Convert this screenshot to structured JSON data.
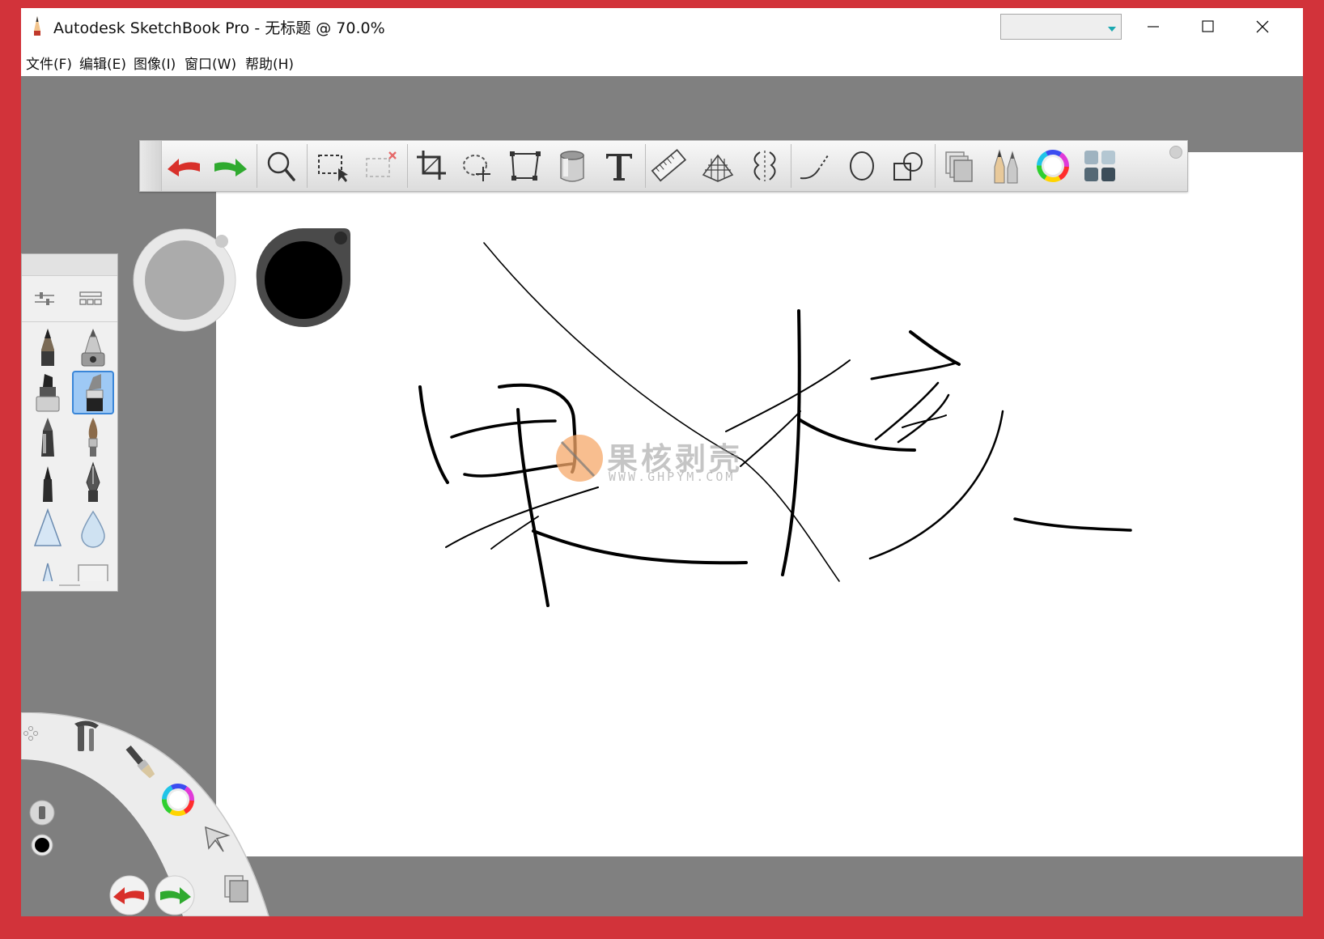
{
  "window": {
    "title": "Autodesk SketchBook Pro - 无标题 @ 70.0%",
    "profile_select_value": ""
  },
  "menu": {
    "items": [
      {
        "label": "文件(F)"
      },
      {
        "label": "编辑(E)"
      },
      {
        "label": "图像(I)"
      },
      {
        "label": "窗口(W)"
      },
      {
        "label": "帮助(H)"
      }
    ]
  },
  "toolbar": {
    "tools": [
      {
        "icon": "undo-icon"
      },
      {
        "icon": "redo-icon"
      },
      {
        "icon": "zoom-icon"
      },
      {
        "icon": "select-icon"
      },
      {
        "icon": "clear-selection-icon"
      },
      {
        "icon": "crop-icon"
      },
      {
        "icon": "lasso-move-icon"
      },
      {
        "icon": "transform-icon"
      },
      {
        "icon": "fill-bucket-icon"
      },
      {
        "icon": "text-icon"
      },
      {
        "icon": "ruler-icon"
      },
      {
        "icon": "perspective-icon"
      },
      {
        "icon": "symmetry-icon"
      },
      {
        "icon": "curve-icon"
      },
      {
        "icon": "ellipse-icon"
      },
      {
        "icon": "shapes-icon"
      },
      {
        "icon": "layers-icon"
      },
      {
        "icon": "brush-library-icon"
      },
      {
        "icon": "color-wheel-icon"
      },
      {
        "icon": "copic-palette-icon"
      }
    ]
  },
  "colors": {
    "background": "#d2333a",
    "workspace": "#808080",
    "canvas": "#ffffff",
    "undo": "#d8302a",
    "redo": "#2faa2f",
    "selected_brush": "#9ec9f5",
    "brush_color": "#000000",
    "watermark_orange": "#f6a869"
  },
  "brushes": {
    "selected_index": 3,
    "items": [
      {
        "icon": "pencil-icon"
      },
      {
        "icon": "airbrush-icon"
      },
      {
        "icon": "marker-icon"
      },
      {
        "icon": "chisel-marker-icon"
      },
      {
        "icon": "ballpoint-pen-icon"
      },
      {
        "icon": "paintbrush-icon"
      },
      {
        "icon": "felt-pen-icon"
      },
      {
        "icon": "ink-pen-icon"
      },
      {
        "icon": "hard-eraser-icon"
      },
      {
        "icon": "soft-eraser-icon"
      },
      {
        "icon": "smudge-icon"
      },
      {
        "icon": "eraser-block-icon"
      }
    ]
  },
  "watermark": {
    "text": "果核剥壳",
    "url": "WWW.GHPYM.COM"
  }
}
